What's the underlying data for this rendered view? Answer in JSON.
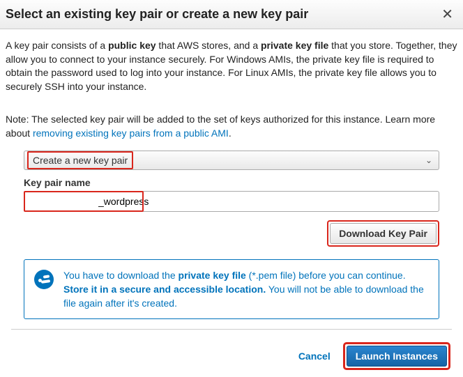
{
  "dialog": {
    "title": "Select an existing key pair or create a new key pair"
  },
  "description": {
    "pre": "A key pair consists of a ",
    "pub": "public key",
    "mid1": " that AWS stores, and a ",
    "priv": "private key file",
    "post": " that you store. Together, they allow you to connect to your instance securely. For Windows AMIs, the private key file is required to obtain the password used to log into your instance. For Linux AMIs, the private key file allows you to securely SSH into your instance."
  },
  "note": {
    "text": "Note: The selected key pair will be added to the set of keys authorized for this instance. Learn more about ",
    "link": "removing existing key pairs from a public AMI",
    "period": "."
  },
  "form": {
    "select_value": "Create a new key pair",
    "keypair_label": "Key pair name",
    "keypair_value": "_wordpress",
    "download_btn": "Download Key Pair"
  },
  "info": {
    "p1_pre": "You have to download the ",
    "p1_bold": "private key file",
    "p1_post": " (*.pem file) before you can continue. ",
    "p2_bold": "Store it in a secure and accessible location.",
    "p2_post": " You will not be able to download the file again after it's created."
  },
  "footer": {
    "cancel": "Cancel",
    "launch": "Launch Instances"
  }
}
